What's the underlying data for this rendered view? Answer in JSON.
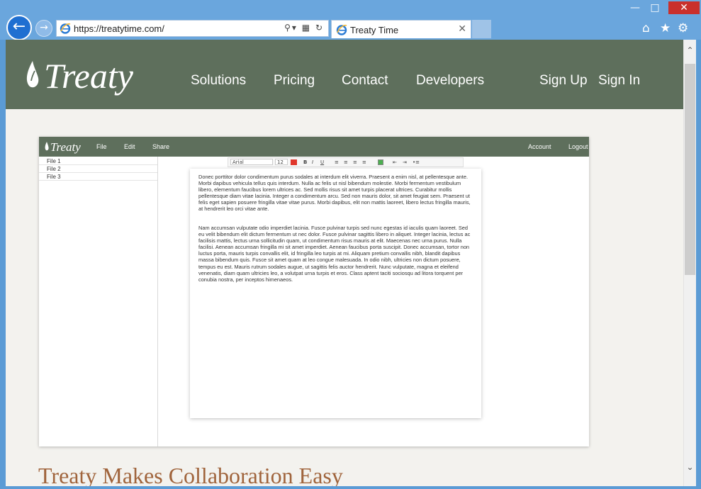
{
  "browser": {
    "address": "https://treatytime.com/",
    "tab_title": "Treaty Time",
    "window_controls": [
      "minimize",
      "maximize",
      "close"
    ],
    "toolbar_icons": [
      "home-icon",
      "star-icon",
      "gear-icon"
    ]
  },
  "site": {
    "brand": "Treaty",
    "nav": [
      "Solutions",
      "Pricing",
      "Contact",
      "Developers"
    ],
    "auth": [
      "Sign Up",
      "Sign In"
    ],
    "tagline": "Treaty Makes Collaboration Easy"
  },
  "app": {
    "brand": "Treaty",
    "menu": [
      "File",
      "Edit",
      "Share"
    ],
    "right_menu": [
      "Account",
      "Logout"
    ],
    "files": [
      "File 1",
      "File 2",
      "File 3"
    ],
    "toolbar": {
      "font": "Arial",
      "size": "12"
    },
    "document": {
      "paragraphs": [
        "Donec porttitor dolor condimentum purus sodales at interdum elit viverra. Praesent a enim nisl, at pellentesque ante. Morbi dapibus vehicula tellus quis interdum. Nulla ac felis ut nisl bibendum molestie. Morbi fermentum vestibulum libero, elementum faucibus lorem ultrices ac. Sed mollis risus sit amet turpis placerat ultrices. Curabitur mollis pellentesque diam vitae lacinia. Integer a condimentum arcu. Sed non mauris dolor, sit amet feugiat sem. Praesent ut felis eget sapien posuere fringilla vitae vitae purus. Morbi dapibus, elit non mattis laoreet, libero lectus fringilla mauris, at hendrerit leo orci vitae ante.",
        "Nam accumsan vulputate odio imperdiet lacinia. Fusce pulvinar turpis sed nunc egestas id iaculis quam laoreet. Sed eu velit bibendum elit dictum fermentum ut nec dolor. Fusce pulvinar sagittis libero in aliquet. Integer lacinia, lectus ac facilisis mattis, lectus urna sollicitudin quam, ut condimentum risus mauris at elit. Maecenas nec urna purus. Nulla facilisi. Aenean accumsan fringilla mi sit amet imperdiet. Aenean faucibus porta suscipit. Donec accumsan, tortor non luctus porta, mauris turpis convallis elit, id fringilla leo turpis at mi. Aliquam pretium convallis nibh, blandit dapibus massa bibendum quis. Fusce sit amet quam at leo congue malesuada. In odio nibh, ultricies non dictum posuere, tempus eu est. Mauris rutrum sodales augue, ut sagittis felis auctor hendrerit. Nunc vulputate, magna et eleifend venenatis, diam quam ultricies leo, a volutpat urna turpis et eros. Class aptent taciti sociosqu ad litora torquent per conubia nostra, per inceptos himenaeos."
      ]
    }
  },
  "colors": {
    "header_green": "#5e6f5c",
    "tagline_brown": "#a0643c",
    "chrome_blue": "#6aa6dd",
    "close_red": "#c9302c"
  }
}
